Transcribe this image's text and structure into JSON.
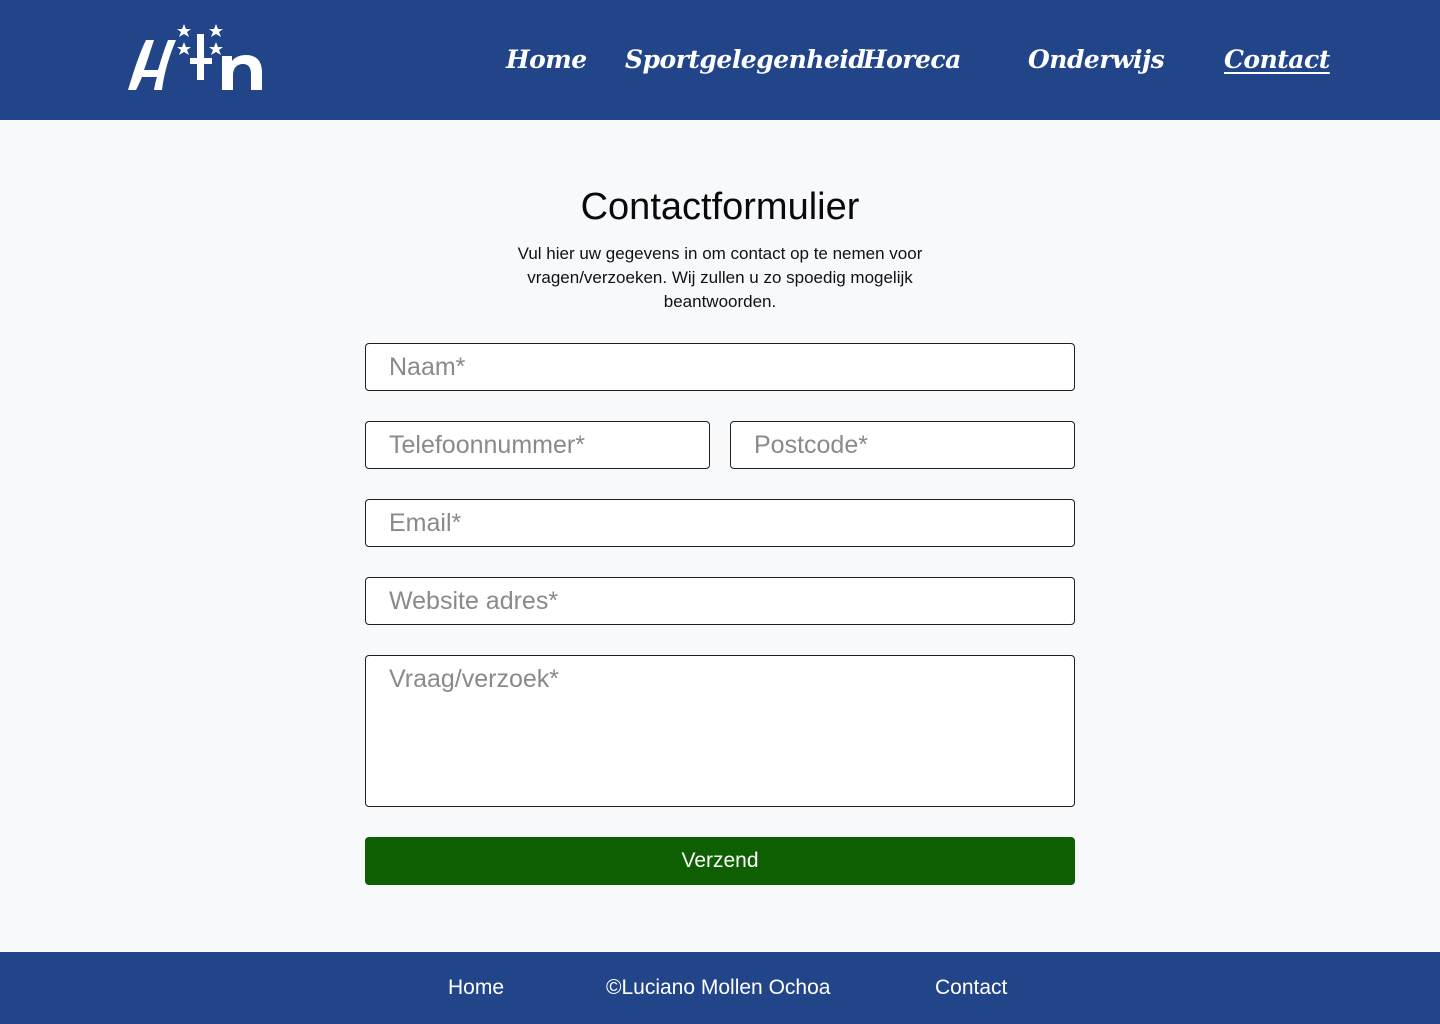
{
  "colors": {
    "header_bg": "#22458a",
    "footer_bg": "#22458a",
    "page_bg": "#f8f9fb",
    "submit_bg": "#0e5e02"
  },
  "header": {
    "logo_icon": "hln-logo-icon",
    "nav": [
      {
        "label": "Home",
        "active": false
      },
      {
        "label": "Sportgelegenheid",
        "active": false
      },
      {
        "label": "Horeca",
        "active": false
      },
      {
        "label": "Onderwijs",
        "active": false
      },
      {
        "label": "Contact",
        "active": true
      }
    ]
  },
  "form": {
    "title": "Contactformulier",
    "intro": "Vul hier uw gegevens in om contact op te nemen voor vragen/verzoeken. Wij zullen u zo spoedig mogelijk beantwoorden.",
    "fields": {
      "naam": {
        "placeholder": "Naam*",
        "value": ""
      },
      "telefoon": {
        "placeholder": "Telefoonnummer*",
        "value": ""
      },
      "postcode": {
        "placeholder": "Postcode*",
        "value": ""
      },
      "email": {
        "placeholder": "Email*",
        "value": ""
      },
      "website": {
        "placeholder": "Website adres*",
        "value": ""
      },
      "vraag": {
        "placeholder": "Vraag/verzoek*",
        "value": ""
      }
    },
    "submit_label": "Verzend"
  },
  "footer": {
    "home": "Home",
    "copyright": "©Luciano Mollen Ochoa",
    "contact": "Contact"
  }
}
